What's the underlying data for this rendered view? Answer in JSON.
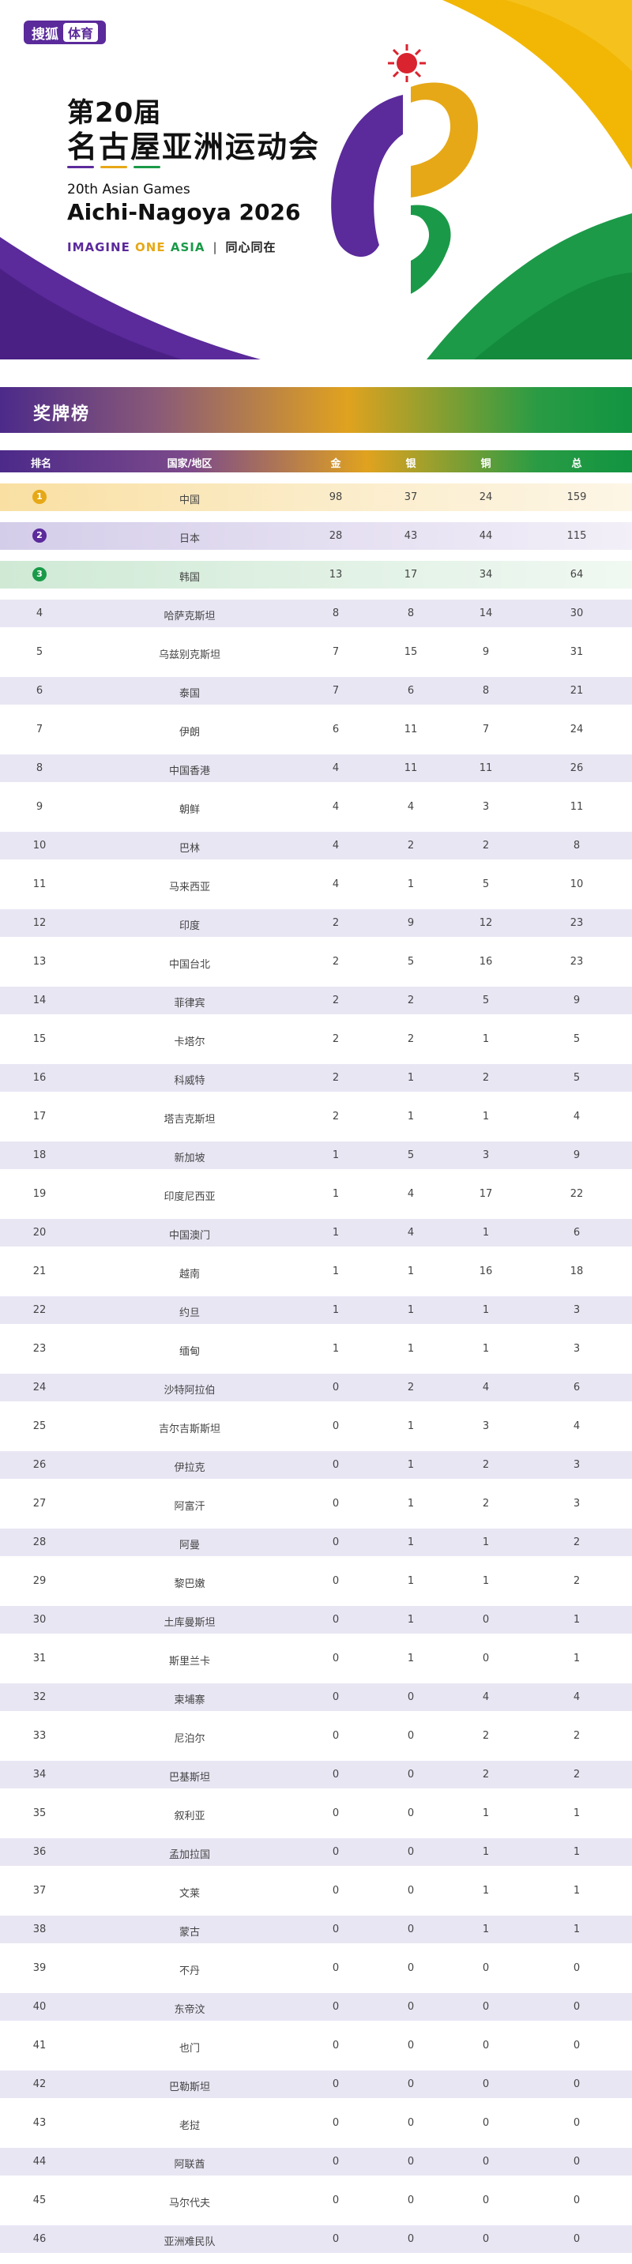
{
  "brand": {
    "name": "搜狐",
    "sub": "体育"
  },
  "hero": {
    "title_line1": "第20届",
    "title_line2": "名古屋亚洲运动会",
    "subtitle_en1": "20th Asian Games",
    "subtitle_en2": "Aichi-Nagoya 2026",
    "slogan_imagine": "IMAGINE",
    "slogan_one": "ONE",
    "slogan_asia": "ASIA",
    "slogan_separator": "|",
    "slogan_cn": "同心同在"
  },
  "colors": {
    "purple": "#5b2a9b",
    "gold": "#e6a817",
    "green": "#1a9a48",
    "red": "#d9232e"
  },
  "section_title": "奖牌榜",
  "table": {
    "headers": {
      "rank": "排名",
      "country": "国家/地区",
      "gold": "金",
      "silver": "银",
      "bronze": "铜",
      "total": "总"
    },
    "rows": [
      {
        "rank": "1",
        "country": "中国",
        "gold": "98",
        "silver": "37",
        "bronze": "24",
        "total": "159"
      },
      {
        "rank": "2",
        "country": "日本",
        "gold": "28",
        "silver": "43",
        "bronze": "44",
        "total": "115"
      },
      {
        "rank": "3",
        "country": "韩国",
        "gold": "13",
        "silver": "17",
        "bronze": "34",
        "total": "64"
      },
      {
        "rank": "4",
        "country": "哈萨克斯坦",
        "gold": "8",
        "silver": "8",
        "bronze": "14",
        "total": "30"
      },
      {
        "rank": "5",
        "country": "乌兹别克斯坦",
        "gold": "7",
        "silver": "15",
        "bronze": "9",
        "total": "31"
      },
      {
        "rank": "6",
        "country": "泰国",
        "gold": "7",
        "silver": "6",
        "bronze": "8",
        "total": "21"
      },
      {
        "rank": "7",
        "country": "伊朗",
        "gold": "6",
        "silver": "11",
        "bronze": "7",
        "total": "24"
      },
      {
        "rank": "8",
        "country": "中国香港",
        "gold": "4",
        "silver": "11",
        "bronze": "11",
        "total": "26"
      },
      {
        "rank": "9",
        "country": "朝鲜",
        "gold": "4",
        "silver": "4",
        "bronze": "3",
        "total": "11"
      },
      {
        "rank": "10",
        "country": "巴林",
        "gold": "4",
        "silver": "2",
        "bronze": "2",
        "total": "8"
      },
      {
        "rank": "11",
        "country": "马来西亚",
        "gold": "4",
        "silver": "1",
        "bronze": "5",
        "total": "10"
      },
      {
        "rank": "12",
        "country": "印度",
        "gold": "2",
        "silver": "9",
        "bronze": "12",
        "total": "23"
      },
      {
        "rank": "13",
        "country": "中国台北",
        "gold": "2",
        "silver": "5",
        "bronze": "16",
        "total": "23"
      },
      {
        "rank": "14",
        "country": "菲律宾",
        "gold": "2",
        "silver": "2",
        "bronze": "5",
        "total": "9"
      },
      {
        "rank": "15",
        "country": "卡塔尔",
        "gold": "2",
        "silver": "2",
        "bronze": "1",
        "total": "5"
      },
      {
        "rank": "16",
        "country": "科威特",
        "gold": "2",
        "silver": "1",
        "bronze": "2",
        "total": "5"
      },
      {
        "rank": "17",
        "country": "塔吉克斯坦",
        "gold": "2",
        "silver": "1",
        "bronze": "1",
        "total": "4"
      },
      {
        "rank": "18",
        "country": "新加坡",
        "gold": "1",
        "silver": "5",
        "bronze": "3",
        "total": "9"
      },
      {
        "rank": "19",
        "country": "印度尼西亚",
        "gold": "1",
        "silver": "4",
        "bronze": "17",
        "total": "22"
      },
      {
        "rank": "20",
        "country": "中国澳门",
        "gold": "1",
        "silver": "4",
        "bronze": "1",
        "total": "6"
      },
      {
        "rank": "21",
        "country": "越南",
        "gold": "1",
        "silver": "1",
        "bronze": "16",
        "total": "18"
      },
      {
        "rank": "22",
        "country": "约旦",
        "gold": "1",
        "silver": "1",
        "bronze": "1",
        "total": "3"
      },
      {
        "rank": "23",
        "country": "缅甸",
        "gold": "1",
        "silver": "1",
        "bronze": "1",
        "total": "3"
      },
      {
        "rank": "24",
        "country": "沙特阿拉伯",
        "gold": "0",
        "silver": "2",
        "bronze": "4",
        "total": "6"
      },
      {
        "rank": "25",
        "country": "吉尔吉斯斯坦",
        "gold": "0",
        "silver": "1",
        "bronze": "3",
        "total": "4"
      },
      {
        "rank": "26",
        "country": "伊拉克",
        "gold": "0",
        "silver": "1",
        "bronze": "2",
        "total": "3"
      },
      {
        "rank": "27",
        "country": "阿富汗",
        "gold": "0",
        "silver": "1",
        "bronze": "2",
        "total": "3"
      },
      {
        "rank": "28",
        "country": "阿曼",
        "gold": "0",
        "silver": "1",
        "bronze": "1",
        "total": "2"
      },
      {
        "rank": "29",
        "country": "黎巴嫩",
        "gold": "0",
        "silver": "1",
        "bronze": "1",
        "total": "2"
      },
      {
        "rank": "30",
        "country": "土库曼斯坦",
        "gold": "0",
        "silver": "1",
        "bronze": "0",
        "total": "1"
      },
      {
        "rank": "31",
        "country": "斯里兰卡",
        "gold": "0",
        "silver": "1",
        "bronze": "0",
        "total": "1"
      },
      {
        "rank": "32",
        "country": "柬埔寨",
        "gold": "0",
        "silver": "0",
        "bronze": "4",
        "total": "4"
      },
      {
        "rank": "33",
        "country": "尼泊尔",
        "gold": "0",
        "silver": "0",
        "bronze": "2",
        "total": "2"
      },
      {
        "rank": "34",
        "country": "巴基斯坦",
        "gold": "0",
        "silver": "0",
        "bronze": "2",
        "total": "2"
      },
      {
        "rank": "35",
        "country": "叙利亚",
        "gold": "0",
        "silver": "0",
        "bronze": "1",
        "total": "1"
      },
      {
        "rank": "36",
        "country": "孟加拉国",
        "gold": "0",
        "silver": "0",
        "bronze": "1",
        "total": "1"
      },
      {
        "rank": "37",
        "country": "文莱",
        "gold": "0",
        "silver": "0",
        "bronze": "1",
        "total": "1"
      },
      {
        "rank": "38",
        "country": "蒙古",
        "gold": "0",
        "silver": "0",
        "bronze": "1",
        "total": "1"
      },
      {
        "rank": "39",
        "country": "不丹",
        "gold": "0",
        "silver": "0",
        "bronze": "0",
        "total": "0"
      },
      {
        "rank": "40",
        "country": "东帝汶",
        "gold": "0",
        "silver": "0",
        "bronze": "0",
        "total": "0"
      },
      {
        "rank": "41",
        "country": "也门",
        "gold": "0",
        "silver": "0",
        "bronze": "0",
        "total": "0"
      },
      {
        "rank": "42",
        "country": "巴勒斯坦",
        "gold": "0",
        "silver": "0",
        "bronze": "0",
        "total": "0"
      },
      {
        "rank": "43",
        "country": "老挝",
        "gold": "0",
        "silver": "0",
        "bronze": "0",
        "total": "0"
      },
      {
        "rank": "44",
        "country": "阿联酋",
        "gold": "0",
        "silver": "0",
        "bronze": "0",
        "total": "0"
      },
      {
        "rank": "45",
        "country": "马尔代夫",
        "gold": "0",
        "silver": "0",
        "bronze": "0",
        "total": "0"
      },
      {
        "rank": "46",
        "country": "亚洲难民队",
        "gold": "0",
        "silver": "0",
        "bronze": "0",
        "total": "0"
      }
    ]
  }
}
